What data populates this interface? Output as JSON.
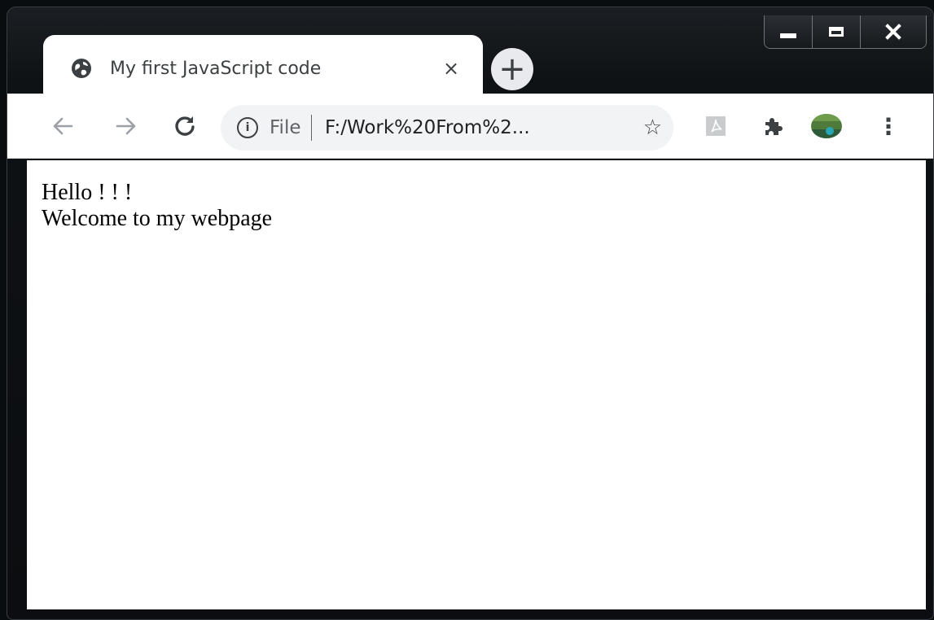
{
  "window": {
    "controls": {
      "minimize": "minimize",
      "maximize": "maximize",
      "close": "close"
    }
  },
  "tab": {
    "title": "My first JavaScript code",
    "close_label": "×",
    "favicon": "globe-icon"
  },
  "newtab": {
    "label": "+"
  },
  "toolbar": {
    "back_icon": "←",
    "forward_icon": "→",
    "reload_icon": "C",
    "omnibox": {
      "info_glyph": "i",
      "scheme": "File",
      "url": "F:/Work%20From%2...",
      "star_icon": "☆"
    },
    "extensions": {
      "pdf_icon": "pdf-extension-icon",
      "puzzle_icon": "puzzle-icon",
      "avatar": "profile-avatar",
      "menu_icon": "⋮"
    }
  },
  "page": {
    "lines": [
      "Hello ! ! !",
      "Welcome to my webpage"
    ]
  },
  "colors": {
    "frame": "#0a0d10",
    "tab": "#ffffff",
    "omnibox": "#f1f3f4",
    "icon": "#5f6368",
    "text": "#000000"
  }
}
